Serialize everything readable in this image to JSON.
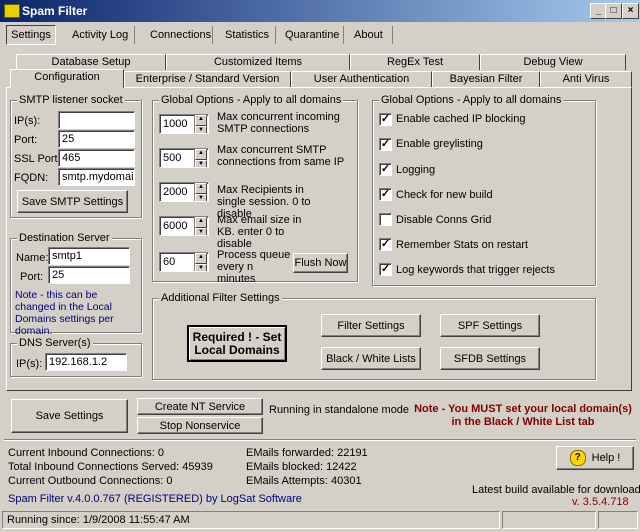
{
  "window": {
    "title": "Spam Filter"
  },
  "menu_tabs": [
    "Settings",
    "Activity Log",
    "Connections",
    "Statistics",
    "Quarantine",
    "About"
  ],
  "sub_tabs_row1": [
    "Database Setup",
    "Customized Items",
    "RegEx Test",
    "Debug View"
  ],
  "sub_tabs_row2": [
    "Configuration",
    "Enterprise / Standard Version",
    "User Authentication",
    "Bayesian Filter",
    "Anti Virus"
  ],
  "smtp": {
    "title": "SMTP listener socket",
    "ip_label": "IP(s):",
    "ip_value": "",
    "port_label": "Port:",
    "port_value": "25",
    "ssl_label": "SSL Port:",
    "ssl_value": "465",
    "fqdn_label": "FQDN:",
    "fqdn_value": "smtp.mydomain.",
    "save_button": "Save SMTP Settings"
  },
  "destination": {
    "title": "Destination Server",
    "name_label": "Name:",
    "name_value": "smtp1",
    "port_label": "Port:",
    "port_value": "25",
    "note": "Note - this can be changed in the Local Domains settings per domain."
  },
  "dns": {
    "title": "DNS Server(s)",
    "ip_label": "IP(s):",
    "ip_value": "192.168.1.2"
  },
  "global_options": {
    "title": "Global Options - Apply to all domains",
    "items": [
      {
        "value": "1000",
        "label": "Max concurrent incoming SMTP connections"
      },
      {
        "value": "500",
        "label": "Max concurrent SMTP connections from same IP"
      },
      {
        "value": "2000",
        "label": "Max Recipients in single session. 0 to disable"
      },
      {
        "value": "6000",
        "label": "Max email size in KB. enter 0 to disable"
      },
      {
        "value": "60",
        "label": "Process queue every n minutes"
      }
    ],
    "flush_button": "Flush Now"
  },
  "global_checks": {
    "title": "Global Options - Apply to all domains",
    "items": [
      {
        "label": "Enable cached IP blocking",
        "checked": true
      },
      {
        "label": "Enable greylisting",
        "checked": true
      },
      {
        "label": "Logging",
        "checked": true
      },
      {
        "label": "Check for new build",
        "checked": true
      },
      {
        "label": "Disable Conns Grid",
        "checked": false
      },
      {
        "label": "Remember Stats on restart",
        "checked": true
      },
      {
        "label": "Log keywords that trigger rejects",
        "checked": true
      }
    ]
  },
  "additional": {
    "title": "Additional Filter Settings",
    "required_button": "Required ! - Set Local Domains",
    "filter_button": "Filter Settings",
    "spf_button": "SPF Settings",
    "bw_button": "Black / White Lists",
    "sfdb_button": "SFDB Settings"
  },
  "bottom": {
    "save_settings": "Save Settings",
    "create_nt": "Create NT Service",
    "stop_nonservice": "Stop Nonservice",
    "mode_status": "Running in standalone mode",
    "note": "Note - You MUST set your local domain(s) in the Black / White List tab",
    "help_button": "Help !"
  },
  "stats": {
    "current_inbound": "Current Inbound Connections: 0",
    "total_inbound": "Total Inbound Connections Served: 45939",
    "current_outbound": "Current Outbound Connections: 0",
    "forwarded": "EMails forwarded: 22191",
    "blocked": "EMails blocked: 12422",
    "attempts": "EMails Attempts: 40301",
    "version": "Spam Filter v.4.0.0.767 (REGISTERED) by LogSat Software",
    "latest_label": "Latest build available for download:",
    "latest_version": "v. 3.5.4.718"
  },
  "statusbar": {
    "running_since": "Running since: 1/9/2008 11:55:47 AM"
  },
  "colors": {
    "note_red": "#800000",
    "note_blue": "#000080",
    "title_start": "#0a246a",
    "title_end": "#a6caf0"
  }
}
